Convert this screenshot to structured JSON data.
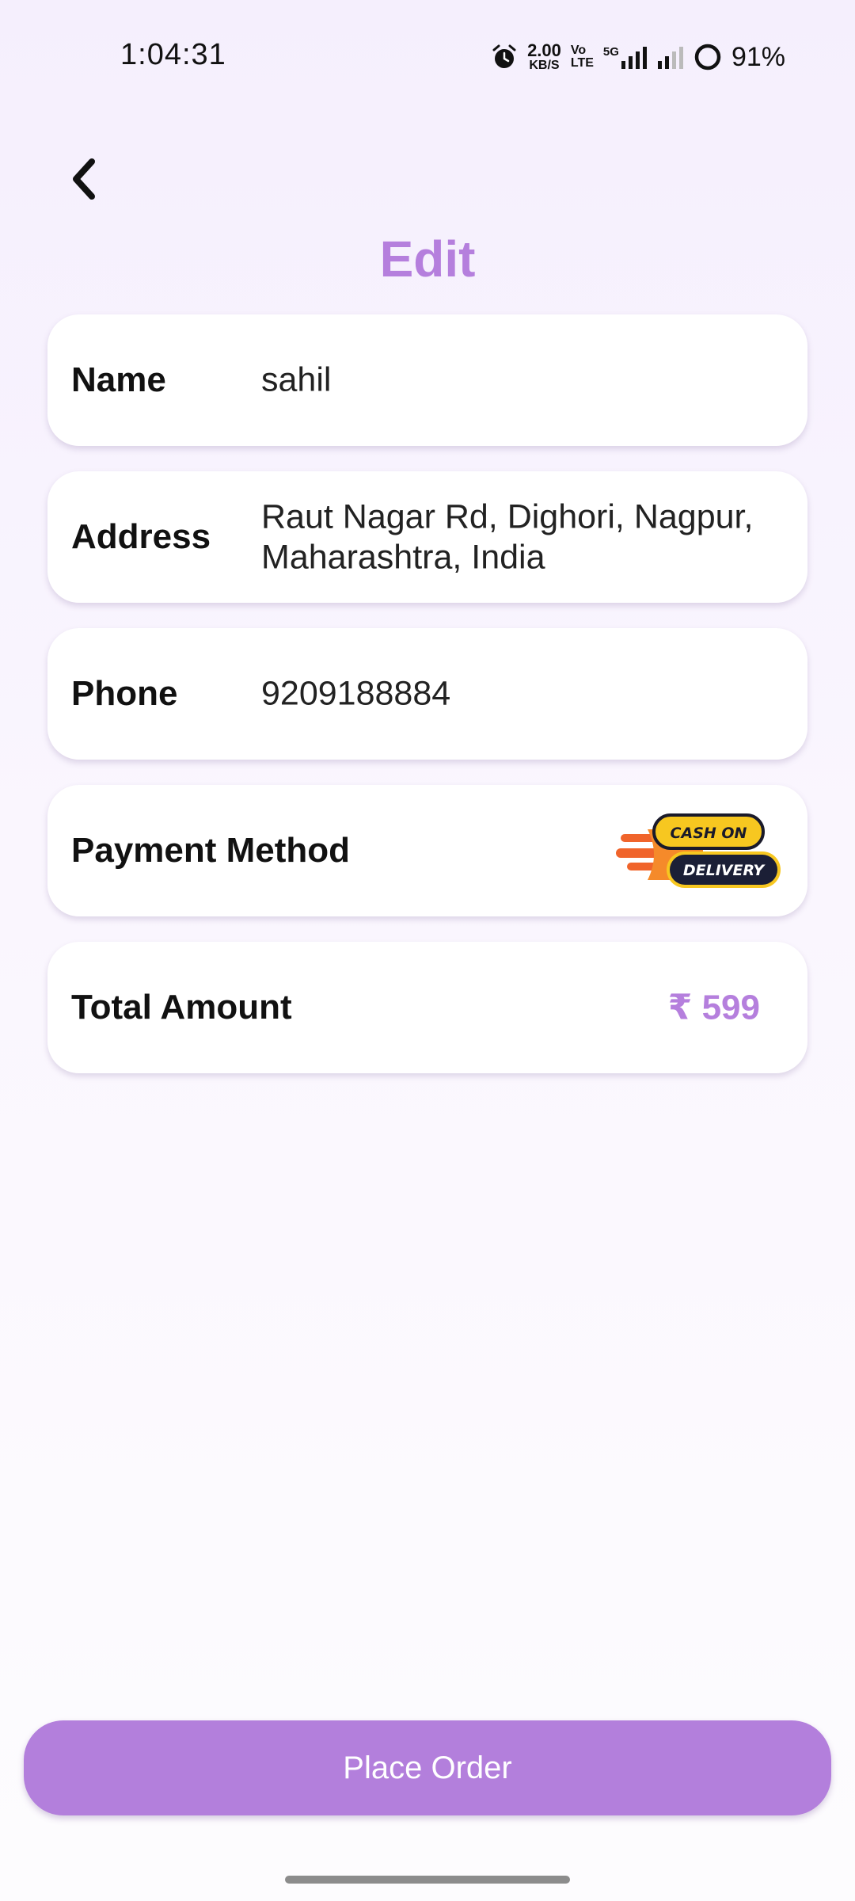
{
  "status_bar": {
    "time": "1:04:31",
    "net_speed_value": "2.00",
    "net_speed_unit": "KB/S",
    "volte_line1": "Vo",
    "volte_line2": "LTE",
    "network_type": "5G",
    "battery_percent": "91%",
    "icons": [
      "alarm-icon",
      "signal-5g-icon",
      "signal-icon",
      "battery-ring-icon"
    ]
  },
  "header": {
    "back_icon": "chevron-left-icon",
    "title": "Edit"
  },
  "form": {
    "name": {
      "label": "Name",
      "value": "sahil"
    },
    "address": {
      "label": "Address",
      "value": "Raut Nagar Rd, Dighori, Nagpur, Maharashtra, India"
    },
    "phone": {
      "label": "Phone",
      "value": "9209188884"
    },
    "payment": {
      "label": "Payment Method",
      "badge_line1": "CASH ON",
      "badge_line2": "DELIVERY"
    },
    "total": {
      "label": "Total Amount",
      "value": "₹ 599"
    }
  },
  "actions": {
    "place_order_label": "Place Order"
  },
  "colors": {
    "accent": "#b57fdd",
    "button": "#b37fdc",
    "background_top": "#f5effd",
    "card": "#ffffff"
  }
}
